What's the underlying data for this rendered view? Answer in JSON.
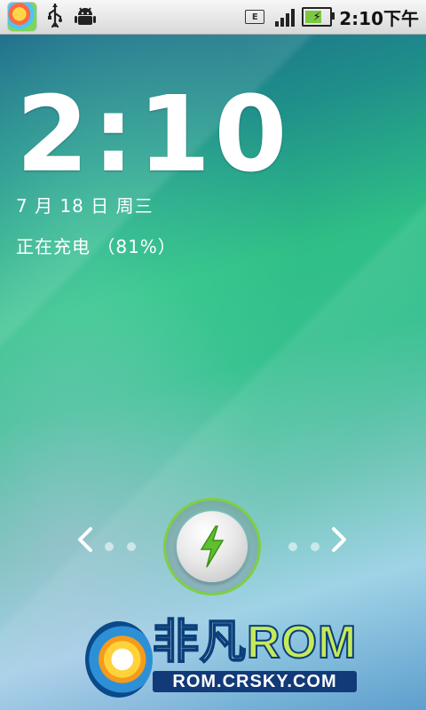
{
  "status_bar": {
    "time": "2:10",
    "time_suffix": "下午",
    "network_badge": "E",
    "icons": [
      "app-launcher-icon",
      "usb-icon",
      "android-debug-icon",
      "signal-icon",
      "battery-charging-icon"
    ]
  },
  "lockscreen": {
    "clock": "2:10",
    "date": "7 月 18 日 周三",
    "charging_status": "正在充电 （81%）",
    "battery_percent": 81
  },
  "unlock": {
    "handle_icon": "lightning-icon",
    "left_arrow_icon": "chevron-left-icon",
    "right_arrow_icon": "chevron-right-icon"
  },
  "watermark": {
    "brand_cn": "非凡",
    "brand_rom": "ROM",
    "url": "ROM.CRSKY.COM"
  },
  "colors": {
    "accent_green": "#7fcf44",
    "statusbar_bg": "#e6e6e6"
  }
}
